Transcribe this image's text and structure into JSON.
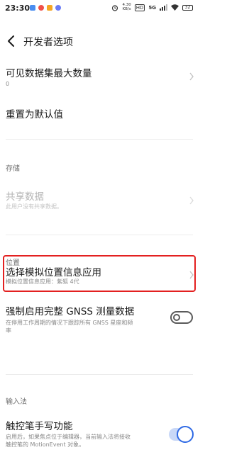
{
  "status_bar": {
    "time": "23:30",
    "net_speed_value": "4.30",
    "net_speed_unit": "KB/s",
    "hd_label": "HD",
    "network_label": "5G",
    "battery_level": "32"
  },
  "header": {
    "title": "开发者选项"
  },
  "rows": {
    "visible_dataset_max": {
      "title": "可见数据集最大数量",
      "value": "0"
    },
    "reset_default": {
      "title": "重置为默认值"
    },
    "shared_data": {
      "title": "共享数据",
      "subtitle": "此用户没有共享数据。"
    },
    "mock_location": {
      "title": "选择模拟位置信息应用",
      "subtitle": "模拟位置信息应用：紫狐 4代"
    },
    "gnss": {
      "title": "强制启用完整 GNSS 测量数据",
      "subtitle_line1": "在停用工作周期的情况下跟踪所有 GNSS 星座和频",
      "subtitle_line2": "率",
      "enabled": false
    },
    "stylus": {
      "title": "触控笔手写功能",
      "subtitle_line1": "启用后，如果焦点位于编辑器，当前输入法将接收",
      "subtitle_line2": "触控笔的 MotionEvent 对象。",
      "enabled": true
    }
  },
  "sections": {
    "storage": "存储",
    "location": "位置",
    "input_method": "输入法"
  },
  "colors": {
    "highlight": "#e32020",
    "toggle_on": "#2f6ae5"
  }
}
